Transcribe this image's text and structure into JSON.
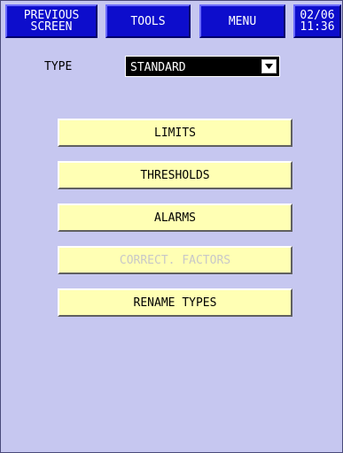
{
  "header": {
    "previous_screen_label": "PREVIOUS\nSCREEN",
    "tools_label": "TOOLS",
    "menu_label": "MENU",
    "clock_text": "02/06\n11:36"
  },
  "type_selector": {
    "label": "TYPE",
    "selected_value": "STANDARD",
    "icon": "dropdown-arrow-icon"
  },
  "menu_buttons": [
    {
      "label": "LIMITS",
      "enabled": true
    },
    {
      "label": "THRESHOLDS",
      "enabled": true
    },
    {
      "label": "ALARMS",
      "enabled": true
    },
    {
      "label": "CORRECT. FACTORS",
      "enabled": false
    },
    {
      "label": "RENAME TYPES",
      "enabled": true
    }
  ],
  "colors": {
    "background": "#c6c7f0",
    "nav_button": "#0d0dcc",
    "menu_button": "#ffffb4",
    "disabled_text": "#c8c8c8"
  }
}
